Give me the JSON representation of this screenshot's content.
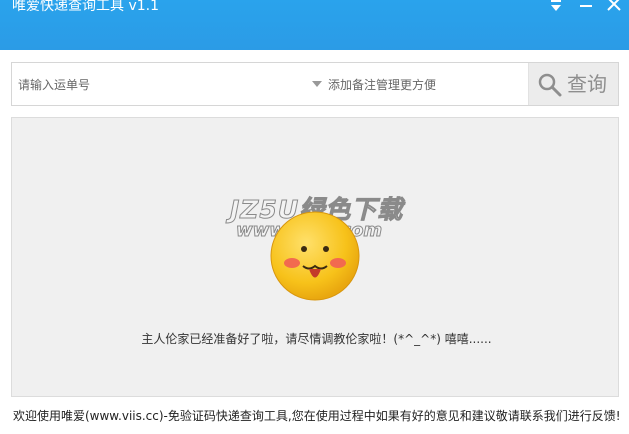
{
  "window": {
    "title": "唯爱快递查询工具 v1.1",
    "title_bar_color": "#2aa3ec",
    "controls": {
      "dropdown_icon": "arrow-down-icon",
      "minimize_icon": "minimize-icon",
      "close_icon": "close-icon"
    }
  },
  "search": {
    "tracking_placeholder": "请输入运单号",
    "note_placeholder": "添加备注管理更方便",
    "query_label": "查询"
  },
  "result": {
    "watermark_title": "JZ5U绿色下载",
    "watermark_url": "www.jz5u.com",
    "status_message": "主人伦家已经准备好了啦，请尽情调教伦家啦！(*^_^*) 嘻嘻......"
  },
  "footer": {
    "text": "欢迎使用唯爱(www.viis.cc)-免验证码快递查询工具,您在使用过程中如果有好的意见和建议敬请联系我们进行反馈!"
  }
}
